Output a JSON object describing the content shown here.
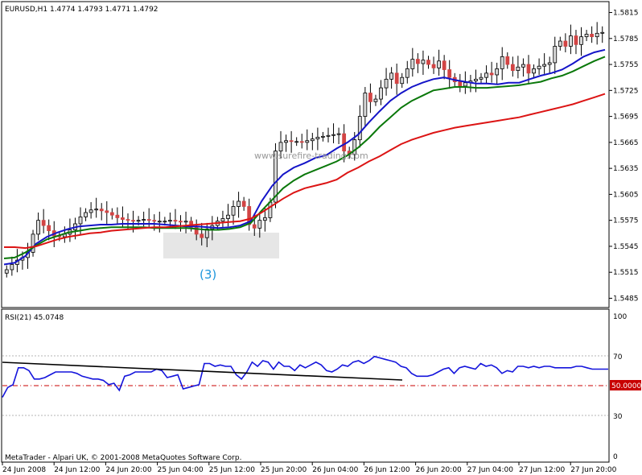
{
  "main_panel": {
    "header": "EURUSD,H1  1.4774 1.4793 1.4771 1.4792",
    "watermark": "www.surefire-trading.com",
    "annotation": "(3)",
    "price_ticks": [
      "1.5815",
      "1.5785",
      "1.5755",
      "1.5725",
      "1.5695",
      "1.5665",
      "1.5635",
      "1.5605",
      "1.5575",
      "1.5545",
      "1.5515",
      "1.5485"
    ]
  },
  "rsi_panel": {
    "header": "RSI(21) 45.0748",
    "levels": [
      "100",
      "70",
      "30",
      "0"
    ],
    "current_label": "50.0000"
  },
  "footer": {
    "copyright": "MetaTrader - Alpari UK, © 2001-2008 MetaQuotes Software Corp.",
    "time_ticks": [
      "24 Jun 2008",
      "24 Jun 12:00",
      "24 Jun 20:00",
      "25 Jun 04:00",
      "25 Jun 12:00",
      "25 Jun 20:00",
      "26 Jun 04:00",
      "26 Jun 12:00",
      "26 Jun 20:00",
      "27 Jun 04:00",
      "27 Jun 12:00",
      "27 Jun 20:00"
    ]
  },
  "colors": {
    "bull_candle": "#d8d8d8",
    "bear_candle": "#d24444",
    "ma_fast": "#1414c8",
    "ma_mid": "#0a780a",
    "ma_slow": "#dc1414",
    "rsi_line": "#1414dc",
    "trendline": "#000000",
    "highlight_box": "#e6e6e6",
    "annotation": "#1e96dc",
    "midline": "#c80000"
  },
  "chart_data": [
    {
      "type": "candlestick",
      "symbol": "EURUSD",
      "timeframe": "H1",
      "title": "EURUSD,H1",
      "ylim": [
        1.5478,
        1.5822
      ],
      "series": [
        {
          "name": "close",
          "values": [
            1.5518,
            1.5524,
            1.5529,
            1.5532,
            1.5538,
            1.5559,
            1.5575,
            1.5569,
            1.5563,
            1.5557,
            1.5556,
            1.5559,
            1.5564,
            1.5571,
            1.5579,
            1.5584,
            1.5587,
            1.5588,
            1.5586,
            1.5584,
            1.5581,
            1.5578,
            1.5576,
            1.5575,
            1.5574,
            1.5575,
            1.5576,
            1.5575,
            1.5574,
            1.5574,
            1.5574,
            1.5575,
            1.5574,
            1.5573,
            1.5574,
            1.5567,
            1.5559,
            1.5555,
            1.5565,
            1.5569,
            1.5574,
            1.5577,
            1.5581,
            1.5591,
            1.5597,
            1.5591,
            1.557,
            1.5566,
            1.5575,
            1.5578,
            1.5596,
            1.5655,
            1.5665,
            1.5667,
            1.5666,
            1.5666,
            1.5665,
            1.5667,
            1.5669,
            1.5671,
            1.5672,
            1.5673,
            1.5674,
            1.5675,
            1.5655,
            1.5651,
            1.5668,
            1.5695,
            1.5722,
            1.5712,
            1.5715,
            1.5728,
            1.5738,
            1.5745,
            1.5733,
            1.574,
            1.575,
            1.5761,
            1.5756,
            1.576,
            1.5755,
            1.5751,
            1.5759,
            1.5749,
            1.574,
            1.5735,
            1.573,
            1.5734,
            1.5736,
            1.5738,
            1.574,
            1.5745,
            1.5743,
            1.575,
            1.5764,
            1.5755,
            1.5748,
            1.5752,
            1.5755,
            1.5745,
            1.575,
            1.5753,
            1.5755,
            1.5757,
            1.5776,
            1.5782,
            1.5776,
            1.5788,
            1.5778,
            1.5787,
            1.579,
            1.5787,
            1.5791,
            1.5792
          ]
        },
        {
          "name": "MA fast",
          "values": [
            1.5524,
            1.5526,
            1.5534,
            1.5548,
            1.5556,
            1.5561,
            1.5565,
            1.5568,
            1.5569,
            1.557,
            1.557,
            1.5571,
            1.5571,
            1.5571,
            1.5571,
            1.557,
            1.5569,
            1.5568,
            1.5568,
            1.5567,
            1.5566,
            1.5567,
            1.5569,
            1.5574,
            1.5597,
            1.5615,
            1.5628,
            1.5636,
            1.5641,
            1.5647,
            1.565,
            1.5658,
            1.5665,
            1.5674,
            1.5688,
            1.5701,
            1.5713,
            1.5722,
            1.5729,
            1.5734,
            1.5738,
            1.574,
            1.5737,
            1.5735,
            1.5733,
            1.5733,
            1.5732,
            1.5734,
            1.5734,
            1.5738,
            1.5742,
            1.5745,
            1.5749,
            1.5756,
            1.5764,
            1.5769,
            1.5772
          ]
        },
        {
          "name": "MA mid",
          "values": [
            1.5531,
            1.5532,
            1.5538,
            1.5546,
            1.5553,
            1.5557,
            1.5561,
            1.5563,
            1.5565,
            1.5566,
            1.5567,
            1.5567,
            1.5567,
            1.5567,
            1.5566,
            1.5566,
            1.5566,
            1.5566,
            1.5565,
            1.5564,
            1.5564,
            1.5565,
            1.5567,
            1.5572,
            1.5586,
            1.5599,
            1.5612,
            1.5621,
            1.5628,
            1.5633,
            1.5638,
            1.5643,
            1.565,
            1.5659,
            1.567,
            1.5683,
            1.5694,
            1.5705,
            1.5713,
            1.5719,
            1.5725,
            1.5727,
            1.5729,
            1.5729,
            1.5728,
            1.5728,
            1.5729,
            1.573,
            1.5731,
            1.5733,
            1.5735,
            1.5739,
            1.5742,
            1.5747,
            1.5753,
            1.5759,
            1.5764
          ]
        },
        {
          "name": "MA slow",
          "values": [
            1.5544,
            1.5544,
            1.5543,
            1.5545,
            1.5549,
            1.5553,
            1.5556,
            1.5558,
            1.556,
            1.5561,
            1.5563,
            1.5564,
            1.5565,
            1.5566,
            1.5567,
            1.5567,
            1.5568,
            1.5569,
            1.557,
            1.5571,
            1.5572,
            1.5573,
            1.5574,
            1.5577,
            1.5584,
            1.5592,
            1.56,
            1.5607,
            1.5612,
            1.5615,
            1.5618,
            1.5622,
            1.563,
            1.5636,
            1.5643,
            1.5649,
            1.5656,
            1.5663,
            1.5668,
            1.5672,
            1.5676,
            1.5679,
            1.5682,
            1.5684,
            1.5686,
            1.5688,
            1.569,
            1.5692,
            1.5694,
            1.5697,
            1.57,
            1.5703,
            1.5706,
            1.5709,
            1.5713,
            1.5717,
            1.5721
          ]
        }
      ]
    },
    {
      "type": "line",
      "title": "RSI(21) 45.0748",
      "ylim": [
        0,
        100
      ],
      "levels": [
        70,
        50,
        30
      ],
      "series": [
        {
          "name": "RSI",
          "values": [
            42,
            49,
            51,
            63,
            63,
            61,
            55,
            55,
            56,
            58,
            60,
            60,
            60,
            60,
            59,
            57,
            56,
            55,
            55,
            54,
            51,
            52,
            47,
            57,
            58,
            60,
            60,
            60,
            60,
            62,
            61,
            56,
            57,
            58,
            48,
            49,
            50,
            51,
            66,
            66,
            64,
            65,
            64,
            64,
            58,
            55,
            60,
            67,
            64,
            68,
            67,
            62,
            67,
            64,
            64,
            61,
            65,
            63,
            65,
            67,
            65,
            61,
            60,
            62,
            65,
            64,
            67,
            68,
            66,
            68,
            71,
            70,
            69,
            68,
            67,
            64,
            63,
            59,
            57,
            57,
            57,
            58,
            60,
            62,
            63,
            59,
            63,
            64,
            63,
            62,
            66,
            64,
            65,
            63,
            59,
            61,
            60,
            64,
            64,
            63,
            64,
            63,
            64,
            64,
            63,
            63,
            63,
            63,
            64,
            64,
            63,
            62,
            62,
            62,
            62
          ]
        },
        {
          "name": "trendline",
          "values": [
            65,
            55
          ]
        }
      ]
    }
  ]
}
